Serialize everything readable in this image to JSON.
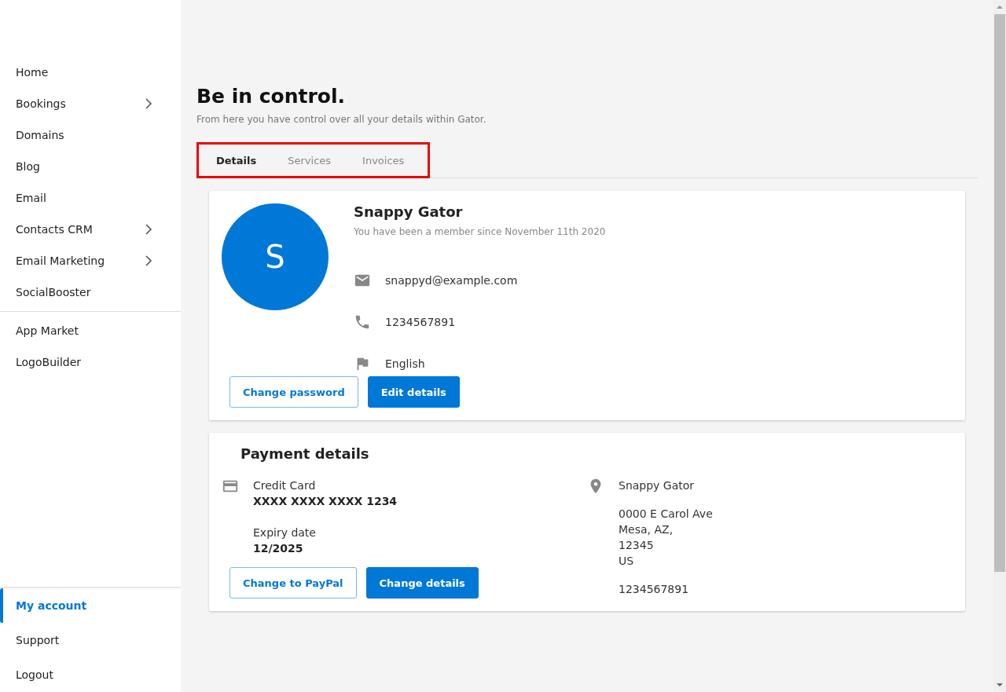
{
  "sidebar": {
    "groups": [
      {
        "items": [
          {
            "label": "Home",
            "expandable": false,
            "selected": false
          },
          {
            "label": "Bookings",
            "expandable": true,
            "selected": false
          },
          {
            "label": "Domains",
            "expandable": false,
            "selected": false
          },
          {
            "label": "Blog",
            "expandable": false,
            "selected": false
          },
          {
            "label": "Email",
            "expandable": false,
            "selected": false
          },
          {
            "label": "Contacts CRM",
            "expandable": true,
            "selected": false
          },
          {
            "label": "Email Marketing",
            "expandable": true,
            "selected": false
          },
          {
            "label": "SocialBooster",
            "expandable": false,
            "selected": false
          }
        ]
      },
      {
        "items": [
          {
            "label": "App Market",
            "expandable": false,
            "selected": false
          },
          {
            "label": "LogoBuilder",
            "expandable": false,
            "selected": false
          }
        ]
      }
    ],
    "footer_items": [
      {
        "label": "My account",
        "selected": true
      },
      {
        "label": "Support",
        "selected": false
      },
      {
        "label": "Logout",
        "selected": false
      }
    ]
  },
  "page": {
    "title": "Be in control.",
    "subtitle": "From here you have control over all your details within Gator."
  },
  "tabs": [
    {
      "label": "Details",
      "selected": true
    },
    {
      "label": "Services",
      "selected": false
    },
    {
      "label": "Invoices",
      "selected": false
    }
  ],
  "profile": {
    "avatar_letter": "S",
    "name": "Snappy Gator",
    "member_since": "You have been a member since November 11th 2020",
    "contacts": [
      {
        "kind": "email",
        "value": "snappyd@example.com"
      },
      {
        "kind": "phone",
        "value": "1234567891"
      },
      {
        "kind": "language",
        "value": "English"
      }
    ],
    "buttons": [
      {
        "label": "Change password",
        "kind": "outline"
      },
      {
        "label": "Edit details",
        "kind": "primary"
      }
    ]
  },
  "payment": {
    "title": "Payment details",
    "method_label": "Credit Card",
    "card_number": "XXXX XXXX XXXX 1234",
    "expiry_label": "Expiry date",
    "expiry": "12/2025",
    "billing_name": "Snappy Gator",
    "address_lines": [
      "0000 E Carol Ave",
      "Mesa, AZ,",
      "12345",
      "US"
    ],
    "phone": "1234567891",
    "buttons": [
      {
        "label": "Change to PayPal",
        "kind": "outline"
      },
      {
        "label": "Change details",
        "kind": "primary"
      }
    ]
  }
}
